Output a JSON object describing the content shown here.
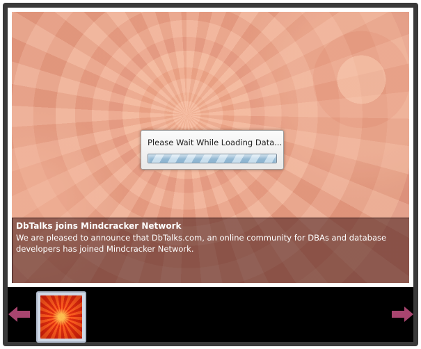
{
  "loading": {
    "message": "Please Wait While Loading Data..."
  },
  "slide": {
    "caption_title": "DbTalks joins Mindcracker Network",
    "caption_body": "We are pleased to announce that DbTalks.com, an online community for DBAs and database developers has joined Mindcracker Network."
  },
  "thumbnails": {
    "count_visible": 1
  },
  "icons": {
    "prev": "left-arrow-icon",
    "next": "right-arrow-icon"
  },
  "colors": {
    "arrow": "#a8456f",
    "frame": "#3a3a3a",
    "strip": "#000000"
  }
}
